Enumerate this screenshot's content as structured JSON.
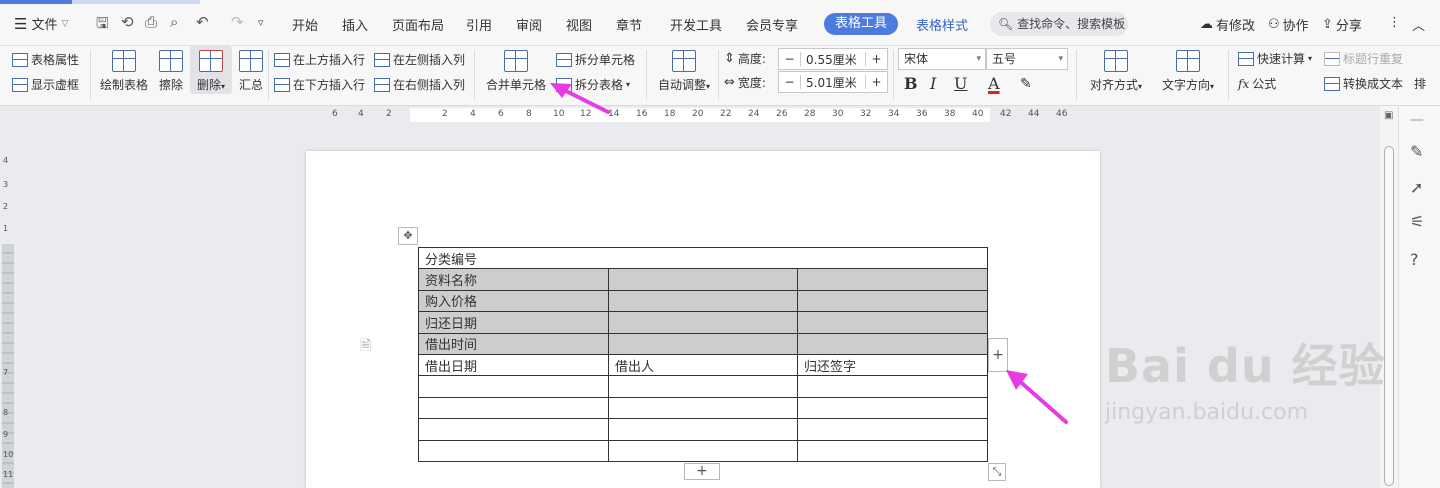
{
  "menubar": {
    "file_label": "文件",
    "tabs": [
      "开始",
      "插入",
      "页面布局",
      "引用",
      "审阅",
      "视图",
      "章节",
      "开发工具",
      "会员专享"
    ],
    "table_tools_tab": "表格工具",
    "table_style_tab": "表格样式",
    "search_placeholder": "查找命令、搜索模板",
    "modified_label": "有修改",
    "collab_label": "协作",
    "share_label": "分享"
  },
  "ribbon": {
    "table_props": "表格属性",
    "show_gridlines": "显示虚框",
    "draw_table": "绘制表格",
    "erase": "擦除",
    "delete": "删除",
    "summary": "汇总",
    "insert_above": "在上方插入行",
    "insert_below": "在下方插入行",
    "insert_left": "在左侧插入列",
    "insert_right": "在右侧插入列",
    "merge_cells": "合并单元格",
    "split_cells": "拆分单元格",
    "split_table": "拆分表格",
    "auto_fit": "自动调整",
    "height_label": "高度:",
    "height_value": "0.55厘米",
    "width_label": "宽度:",
    "width_value": "5.01厘米",
    "font_name": "宋体",
    "font_size": "五号",
    "align": "对齐方式",
    "text_dir": "文字方向",
    "quick_calc": "快速计算",
    "repeat_header": "标题行重复",
    "formula": "公式",
    "to_text": "转换成文本",
    "more": "排",
    "bold": "B",
    "italic": "I",
    "underline": "U",
    "font_color": "A"
  },
  "ruler": {
    "numbers": [
      "6",
      "4",
      "2",
      "2",
      "4",
      "6",
      "8",
      "10",
      "12",
      "14",
      "16",
      "18",
      "20",
      "22",
      "24",
      "26",
      "28",
      "30",
      "32",
      "34",
      "36",
      "38",
      "40",
      "42",
      "44",
      "46"
    ]
  },
  "vruler": {
    "numbers": [
      "4",
      "3",
      "2",
      "1",
      "7",
      "8",
      "9",
      "10",
      "11"
    ]
  },
  "table": {
    "rows": [
      [
        "分类编号"
      ],
      [
        "资料名称",
        "",
        ""
      ],
      [
        "购入价格",
        "",
        ""
      ],
      [
        "归还日期",
        "",
        ""
      ],
      [
        "借出时间",
        "",
        ""
      ],
      [
        "借出日期",
        "借出人",
        "归还签字"
      ],
      [
        "",
        "",
        ""
      ],
      [
        "",
        "",
        ""
      ],
      [
        "",
        "",
        ""
      ],
      [
        "",
        "",
        ""
      ]
    ]
  },
  "watermark": {
    "main": "Bai du 经验",
    "url": "jingyan.baidu.com"
  },
  "colors": {
    "accent": "#4d7cde",
    "arrow": "#e63ce6",
    "cell_gray": "#cdcdcd"
  }
}
